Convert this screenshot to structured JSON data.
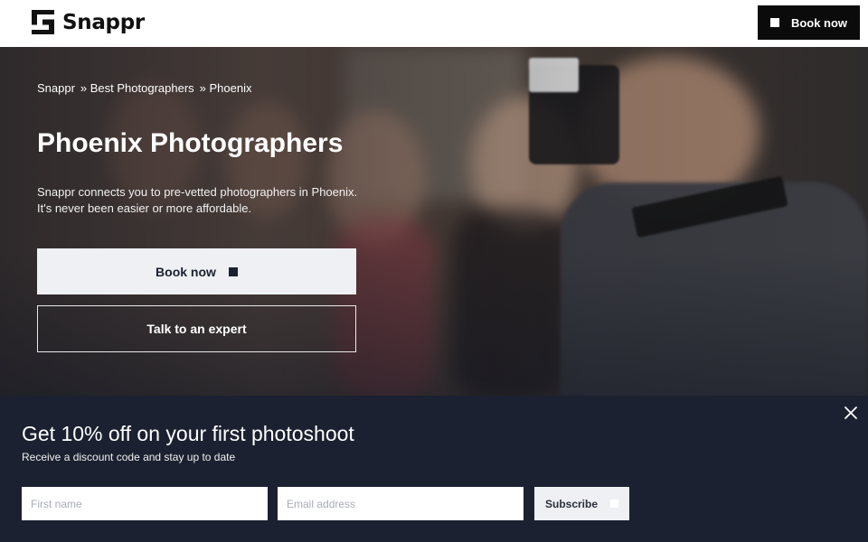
{
  "header": {
    "brand": "Snappr",
    "book_label": "Book now"
  },
  "breadcrumb": [
    {
      "label": "Snappr"
    },
    {
      "label": "» Best Photographers"
    },
    {
      "label": "» Phoenix"
    }
  ],
  "hero": {
    "title": "Phoenix Photographers",
    "description": "Snappr connects you to pre-vetted photographers in Phoenix. It's never been easier or more affordable.",
    "book_label": "Book now",
    "expert_label": "Talk to an expert"
  },
  "promo": {
    "title": "Get 10% off on your first photoshoot",
    "subtitle": "Receive a discount code and stay up to date",
    "first_name_placeholder": "First name",
    "email_placeholder": "Email address",
    "subscribe_label": "Subscribe"
  }
}
